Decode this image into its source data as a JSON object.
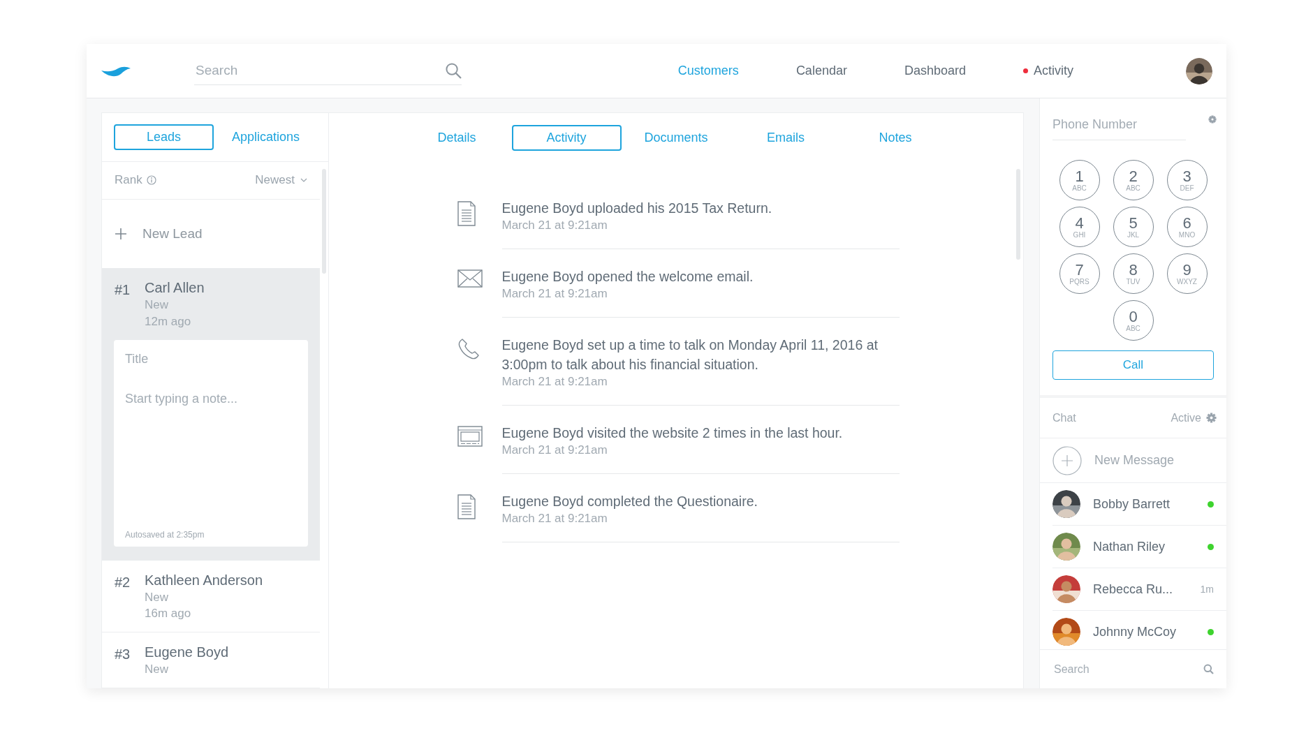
{
  "header": {
    "search": {
      "placeholder": "Search"
    },
    "nav": [
      {
        "label": "Customers",
        "selected": true,
        "alert": false
      },
      {
        "label": "Calendar",
        "selected": false,
        "alert": false
      },
      {
        "label": "Dashboard",
        "selected": false,
        "alert": false
      },
      {
        "label": "Activity",
        "selected": false,
        "alert": true
      }
    ]
  },
  "lead_tabs": [
    {
      "label": "Leads",
      "selected": true
    },
    {
      "label": "Applications",
      "selected": false
    }
  ],
  "sort": {
    "rank_label": "Rank",
    "order": "Newest"
  },
  "new_lead": "New Lead",
  "leads": [
    {
      "rank": "#1",
      "name": "Carl Allen",
      "status": "New",
      "time": "12m ago",
      "selected": true,
      "note": {
        "title_placeholder": "Title",
        "body_placeholder": "Start typing a note...",
        "autosave": "Autosaved at 2:35pm"
      }
    },
    {
      "rank": "#2",
      "name": "Kathleen Anderson",
      "status": "New",
      "time": "16m ago",
      "selected": false
    },
    {
      "rank": "#3",
      "name": "Eugene Boyd",
      "status": "New",
      "selected": false
    }
  ],
  "detail_tabs": [
    {
      "label": "Details",
      "selected": false
    },
    {
      "label": "Activity",
      "selected": true
    },
    {
      "label": "Documents",
      "selected": false
    },
    {
      "label": "Emails",
      "selected": false
    },
    {
      "label": "Notes",
      "selected": false
    }
  ],
  "activities": [
    {
      "kind": "document",
      "text": "Eugene Boyd uploaded his 2015 Tax Return.",
      "date": "March 21 at 9:21am"
    },
    {
      "kind": "email",
      "text": "Eugene Boyd opened the welcome email.",
      "date": "March 21 at 9:21am"
    },
    {
      "kind": "phone",
      "text": "Eugene Boyd set up a time to talk on Monday April 11, 2016 at 3:00pm to talk about his financial situation.",
      "date": "March 21 at 9:21am"
    },
    {
      "kind": "website",
      "text": "Eugene Boyd visited the website 2 times in the last hour.",
      "date": "March 21 at 9:21am"
    },
    {
      "kind": "document",
      "text": "Eugene Boyd completed the Questionaire.",
      "date": "March 21 at 9:21am"
    }
  ],
  "dialer": {
    "placeholder": "Phone Number",
    "keys": [
      {
        "digit": "1",
        "letters": "ABC"
      },
      {
        "digit": "2",
        "letters": "ABC"
      },
      {
        "digit": "3",
        "letters": "DEF"
      },
      {
        "digit": "4",
        "letters": "GHI"
      },
      {
        "digit": "5",
        "letters": "JKL"
      },
      {
        "digit": "6",
        "letters": "MNO"
      },
      {
        "digit": "7",
        "letters": "PQRS"
      },
      {
        "digit": "8",
        "letters": "TUV"
      },
      {
        "digit": "9",
        "letters": "WXYZ"
      },
      {
        "digit": "0",
        "letters": "ABC"
      }
    ],
    "call": "Call"
  },
  "chat": {
    "title": "Chat",
    "status": "Active",
    "new_message": "New Message",
    "contacts": [
      {
        "name": "Bobby Barrett",
        "online": true
      },
      {
        "name": "Nathan Riley",
        "online": true
      },
      {
        "name": "Rebecca Ru...",
        "online": false,
        "time": "1m"
      },
      {
        "name": "Johnny McCoy",
        "online": true
      }
    ],
    "search": {
      "placeholder": "Search"
    }
  }
}
